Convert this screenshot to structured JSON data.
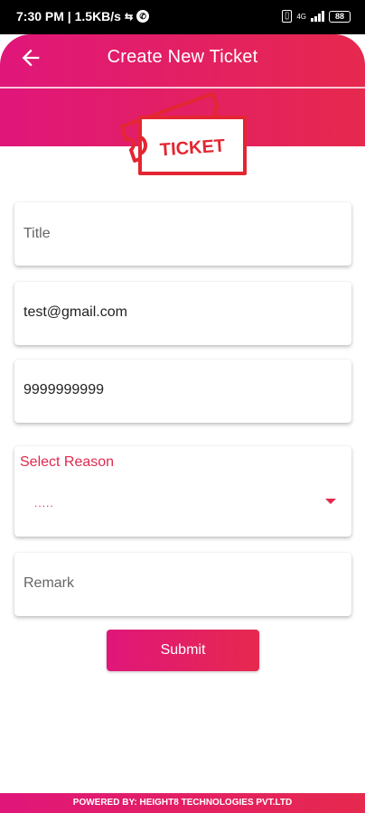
{
  "status_bar": {
    "time_speed": "7:30 PM | 1.5KB/s",
    "battery": "88"
  },
  "header": {
    "title": "Create New Ticket"
  },
  "ticket_art": {
    "text": "TICKET"
  },
  "form": {
    "title": {
      "placeholder": "Title",
      "value": ""
    },
    "email": {
      "value": "test@gmail.com"
    },
    "phone": {
      "value": "9999999999"
    },
    "reason": {
      "label": "Select Reason",
      "selected": "....."
    },
    "remark": {
      "placeholder": "Remark",
      "value": ""
    },
    "submit_label": "Submit"
  },
  "footer": {
    "text": "POWERED BY: HEIGHT8 TECHNOLOGIES PVT.LTD"
  },
  "colors": {
    "gradient_start": "#e0167a",
    "gradient_end": "#e6294e",
    "accent": "#e0294e"
  }
}
